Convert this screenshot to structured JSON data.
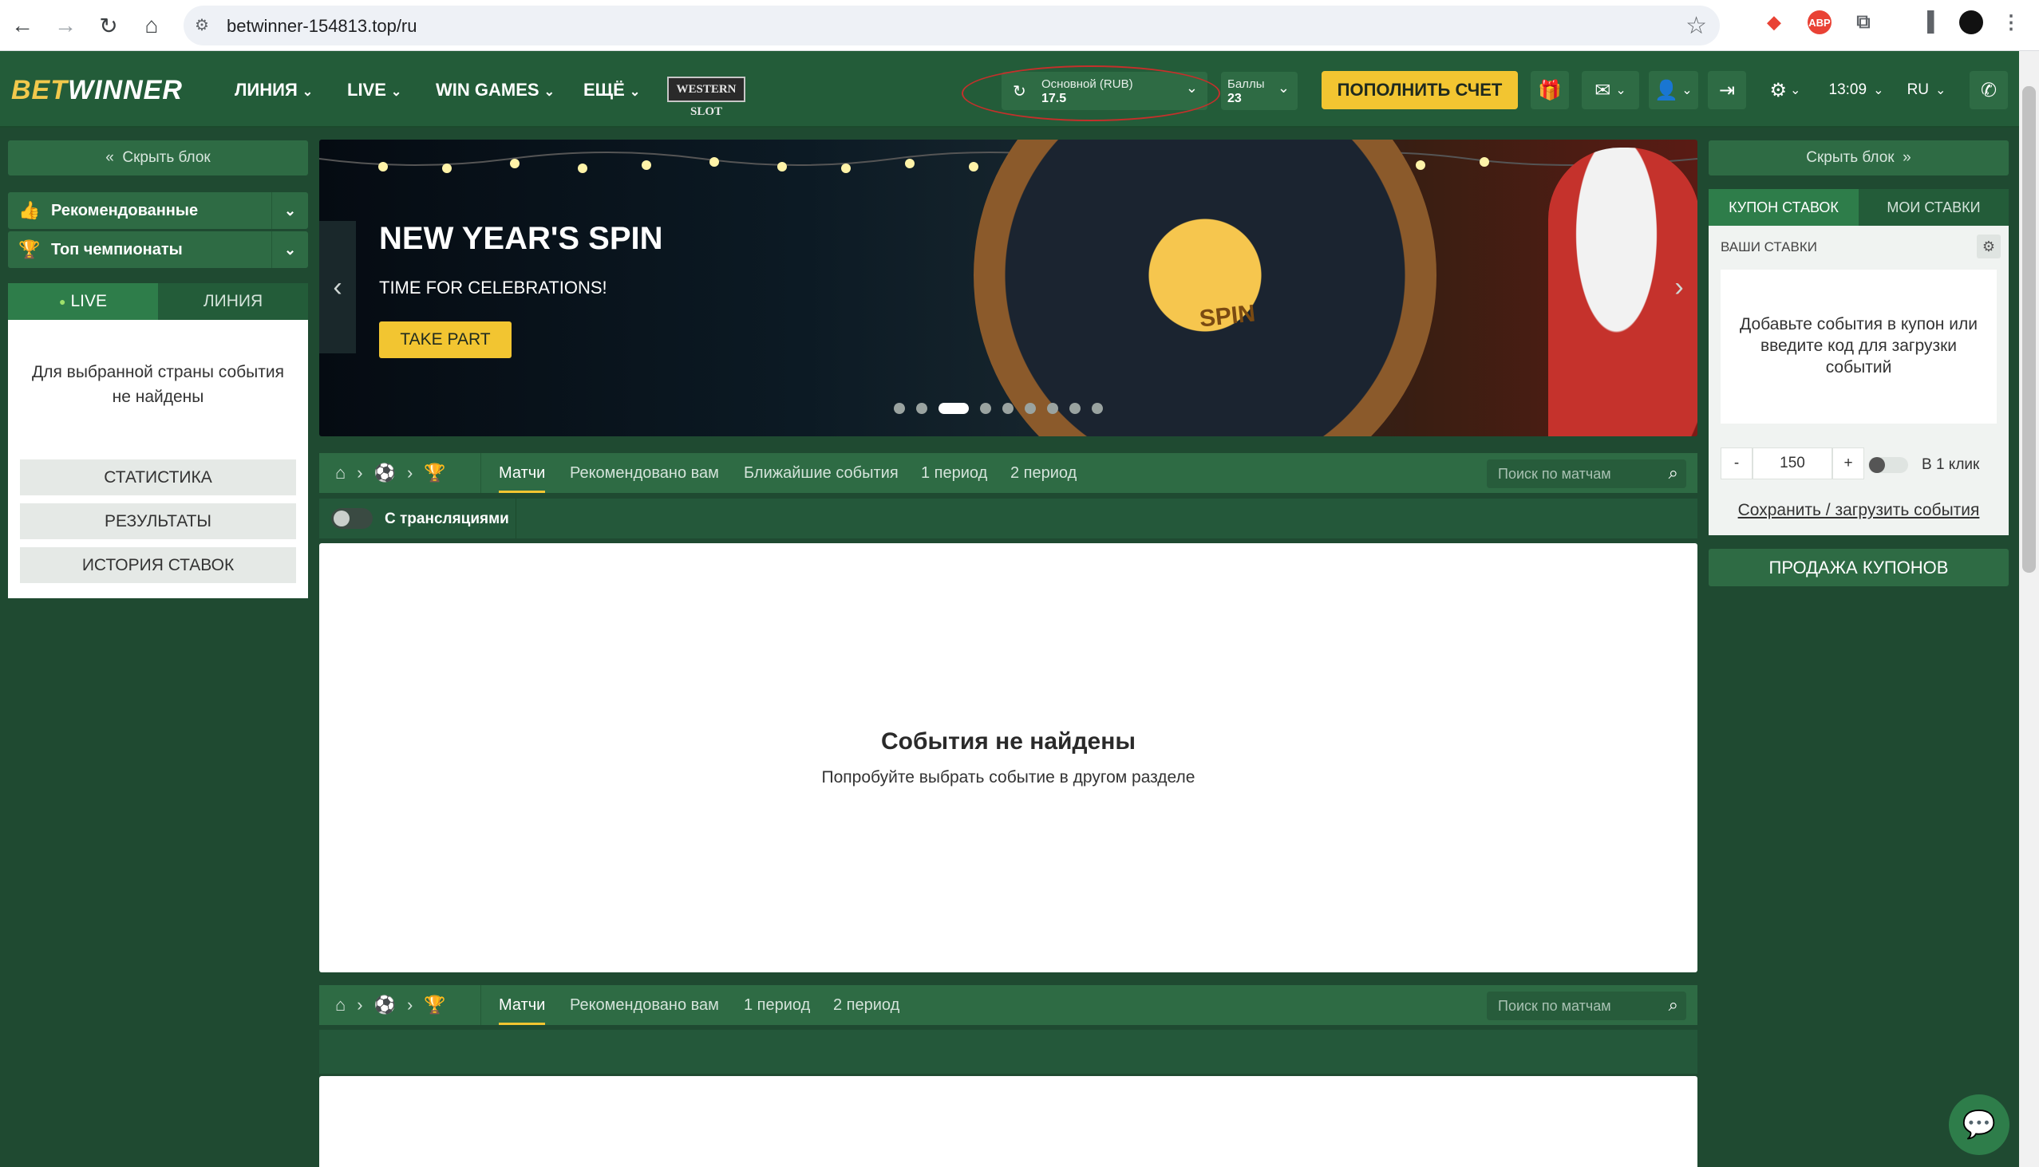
{
  "browser": {
    "url": "betwinner-154813.top/ru"
  },
  "header": {
    "logo_bet": "BET",
    "logo_winner": "WINNER",
    "nav": [
      "ЛИНИЯ",
      "LIVE",
      "WIN GAMES",
      "ЕЩЁ"
    ],
    "western_slot": "WESTERN SLOT",
    "balance_label": "Основной  (RUB)",
    "balance_value": "17.5",
    "points_label": "Баллы",
    "points_value": "23",
    "deposit_label": "ПОПОЛНИТЬ СЧЕТ",
    "time": "13:09",
    "lang": "RU"
  },
  "left": {
    "hide_block": "Скрыть блок",
    "recommended": "Рекомендованные",
    "top_championships": "Топ чемпионаты",
    "tab_live": "LIVE",
    "tab_line": "ЛИНИЯ",
    "no_events": "Для выбранной страны события не найдены",
    "buttons": [
      "СТАТИСТИКА",
      "РЕЗУЛЬТАТЫ",
      "ИСТОРИЯ СТАВОК"
    ]
  },
  "banner": {
    "title": "NEW YEAR'S SPIN",
    "subtitle": "TIME FOR CELEBRATIONS!",
    "cta": "TAKE PART",
    "wheel_center": "SPIN",
    "slide_index": 3,
    "slide_count": 9
  },
  "matches": {
    "tabs": [
      "Матчи",
      "Рекомендовано вам",
      "Ближайшие события",
      "1 период",
      "2 период"
    ],
    "search_placeholder": "Поиск по матчам",
    "streams_label": "С трансляциями",
    "empty_title": "События не найдены",
    "empty_sub": "Попробуйте выбрать событие в другом разделе"
  },
  "matches2": {
    "tabs": [
      "Матчи",
      "Рекомендовано вам",
      "1 период",
      "2 период"
    ],
    "search_placeholder": "Поиск по матчам"
  },
  "right": {
    "hide_block": "Скрыть блок",
    "tab_coupon": "КУПОН СТАВОК",
    "tab_my_bets": "МОИ СТАВКИ",
    "your_bets": "ВАШИ СТАВКИ",
    "empty": "Добавьте события в купон или введите код для загрузки событий",
    "minus": "-",
    "stake": "150",
    "plus": "+",
    "one_click": "В 1 клик",
    "save_load": "Сохранить / загрузить события",
    "sell_coupons": "ПРОДАЖА КУПОНОВ"
  },
  "colors": {
    "site_green": "#235c39",
    "accent_yellow": "#f2c531"
  }
}
